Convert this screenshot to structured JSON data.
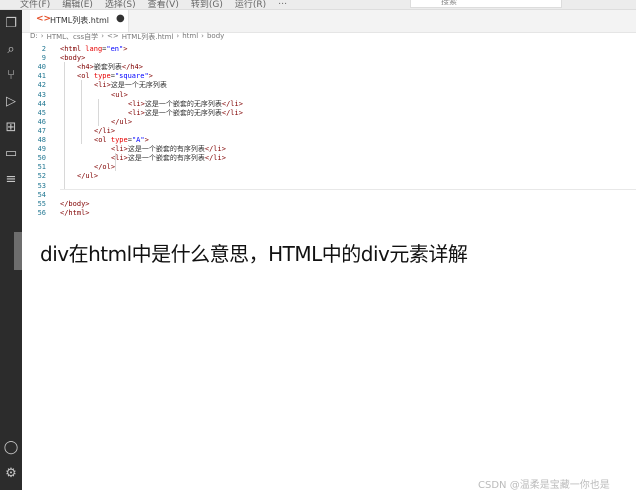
{
  "menu": [
    "文件(F)",
    "编辑(E)",
    "选择(S)",
    "查看(V)",
    "转到(G)",
    "运行(R)",
    "…"
  ],
  "search": {
    "label": "搜索"
  },
  "tab": {
    "label": "HTML列表.html",
    "dot": "●"
  },
  "breadcrumb": [
    "D:",
    "›",
    "HTML、css自学",
    "›",
    "<>",
    "HTML列表.html",
    "›",
    "html",
    "›",
    "body"
  ],
  "editor": {
    "lines": [
      {
        "n": "2",
        "indent": 0,
        "segs": [
          [
            "tag",
            "<html "
          ],
          [
            "attr",
            "lang"
          ],
          [
            "txt",
            "="
          ],
          [
            "val",
            "\"en\""
          ],
          [
            "tag",
            ">"
          ]
        ]
      },
      {
        "n": "9",
        "indent": 0,
        "segs": [
          [
            "tag",
            "<body>"
          ]
        ]
      },
      {
        "n": "40",
        "indent": 1,
        "segs": [
          [
            "tag",
            "<h4>"
          ],
          [
            "txt",
            "嵌套列表"
          ],
          [
            "tag",
            "</h4>"
          ]
        ]
      },
      {
        "n": "41",
        "indent": 1,
        "segs": [
          [
            "tag",
            "<ol "
          ],
          [
            "attr",
            "type"
          ],
          [
            "txt",
            "="
          ],
          [
            "val",
            "\"square\""
          ],
          [
            "tag",
            ">"
          ]
        ]
      },
      {
        "n": "42",
        "indent": 2,
        "segs": [
          [
            "tag",
            "<li>"
          ],
          [
            "txt",
            "这是一个无序列表"
          ]
        ]
      },
      {
        "n": "43",
        "indent": 3,
        "segs": [
          [
            "tag",
            "<ul>"
          ]
        ]
      },
      {
        "n": "44",
        "indent": 4,
        "segs": [
          [
            "tag",
            "<li>"
          ],
          [
            "txt",
            "这是一个嵌套的无序列表"
          ],
          [
            "tag",
            "</li>"
          ]
        ]
      },
      {
        "n": "45",
        "indent": 4,
        "segs": [
          [
            "tag",
            "<li>"
          ],
          [
            "txt",
            "这是一个嵌套的无序列表"
          ],
          [
            "tag",
            "</li>"
          ]
        ]
      },
      {
        "n": "46",
        "indent": 3,
        "segs": [
          [
            "tag",
            "</ul>"
          ]
        ]
      },
      {
        "n": "47",
        "indent": 2,
        "segs": [
          [
            "tag",
            "</li>"
          ]
        ]
      },
      {
        "n": "48",
        "indent": 2,
        "segs": [
          [
            "tag",
            "<ol "
          ],
          [
            "attr",
            "type"
          ],
          [
            "txt",
            "="
          ],
          [
            "val",
            "\"A\""
          ],
          [
            "tag",
            ">"
          ]
        ]
      },
      {
        "n": "49",
        "indent": 3,
        "segs": [
          [
            "tag",
            "<li>"
          ],
          [
            "txt",
            "这是一个嵌套的有序列表"
          ],
          [
            "tag",
            "</li>"
          ]
        ]
      },
      {
        "n": "50",
        "indent": 3,
        "segs": [
          [
            "tag",
            "<li>"
          ],
          [
            "txt",
            "这是一个嵌套的有序列表"
          ],
          [
            "tag",
            "</li>"
          ]
        ]
      },
      {
        "n": "51",
        "indent": 2,
        "segs": [
          [
            "tag",
            "</ol>"
          ]
        ]
      },
      {
        "n": "52",
        "indent": 1,
        "segs": [
          [
            "tag",
            "</ul>"
          ]
        ]
      },
      {
        "n": "53",
        "indent": 0,
        "segs": []
      },
      {
        "n": "54",
        "indent": 0,
        "segs": []
      },
      {
        "n": "55",
        "indent": 0,
        "segs": [
          [
            "tag",
            "</body>"
          ]
        ]
      },
      {
        "n": "56",
        "indent": 0,
        "segs": [
          [
            "tag",
            "</html>"
          ]
        ]
      }
    ]
  },
  "overlay": {
    "title": "div在html中是什么意思，HTML中的div元素详解"
  },
  "watermark": "CSDN @温柔是宝藏一你也是"
}
